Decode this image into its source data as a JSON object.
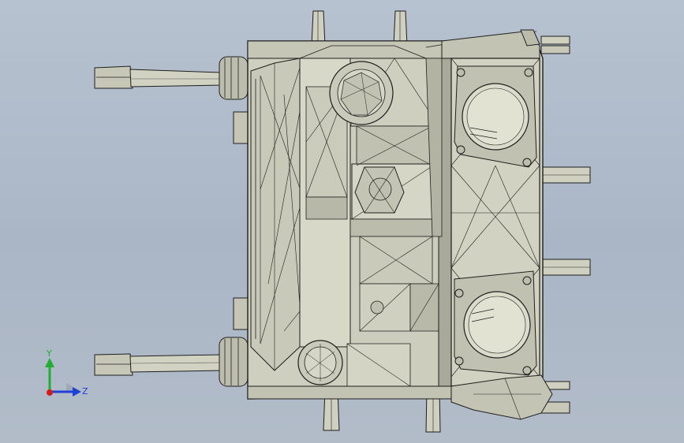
{
  "viewport": {
    "background_top": "#b7c2d0",
    "background_bottom": "#b2bcc9",
    "model_face_color": "#cfcfbf",
    "model_shadow_color": "#a9a99a",
    "edge_color": "#1e1e1e"
  },
  "triad": {
    "y_label": "Y",
    "z_label": "Z",
    "y_color": "#1fae32",
    "z_color": "#1f3fd6",
    "x_color": "#d41b1b"
  }
}
